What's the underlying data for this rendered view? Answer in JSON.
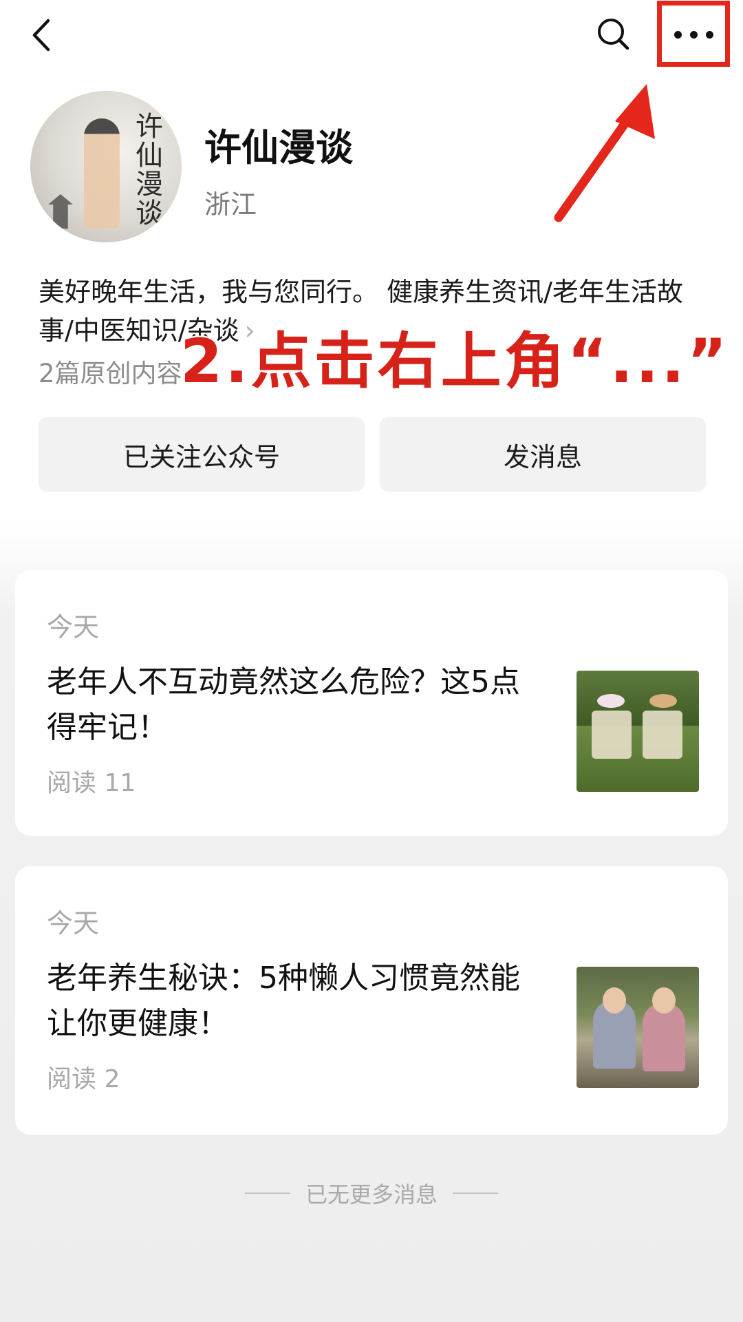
{
  "header": {
    "back_icon": "chevron-left-icon",
    "search_icon": "search-icon",
    "more_icon": "more-horizontal-icon"
  },
  "profile": {
    "name": "许仙漫谈",
    "region": "浙江",
    "avatar_text": "许仙漫谈",
    "bio": "美好晚年生活，我与您同行。 健康养生资讯/老年生活故事/中医知识/杂谈",
    "bio_chevron": "›",
    "original_count": "2篇原创内容"
  },
  "overlay": {
    "instruction": "2.点击右上角“...”",
    "accent": "#d7221a"
  },
  "buttons": {
    "follow_label": "已关注公众号",
    "message_label": "发消息"
  },
  "articles": [
    {
      "date": "今天",
      "title": "老年人不互动竟然这么危险？这5点得牢记！",
      "reads": "阅读 11"
    },
    {
      "date": "今天",
      "title": "老年养生秘诀：5种懒人习惯竟然能让你更健康！",
      "reads": "阅读 2"
    }
  ],
  "footer": {
    "end_text": "已无更多消息"
  }
}
